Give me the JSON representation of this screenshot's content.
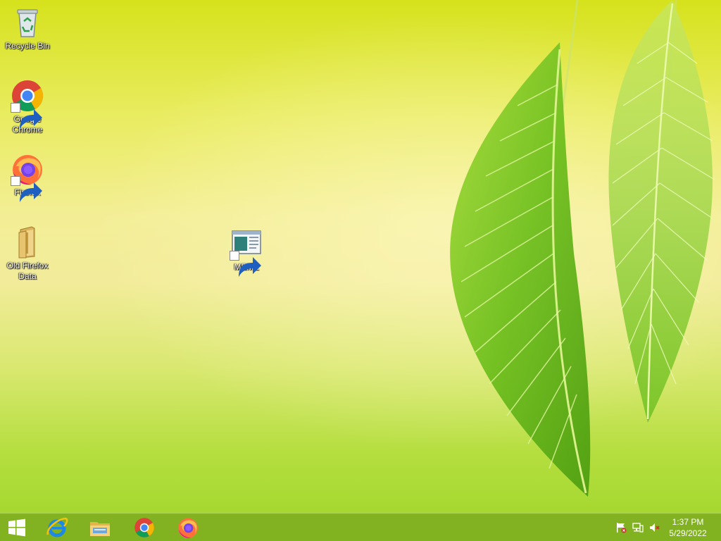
{
  "desktop": {
    "icons": [
      {
        "label": "Recycle Bin"
      },
      {
        "label": "Google Chrome"
      },
      {
        "label": "Firefox"
      },
      {
        "label": "Old Firefox Data"
      },
      {
        "label": "MEMZ"
      }
    ]
  },
  "taskbar": {
    "start_icon": "windows-logo-icon",
    "pinned": [
      {
        "icon": "internet-explorer-icon"
      },
      {
        "icon": "file-explorer-icon"
      },
      {
        "icon": "chrome-icon"
      },
      {
        "icon": "firefox-icon"
      }
    ],
    "tray": {
      "icons": [
        "action-center-flag-icon",
        "network-icon",
        "volume-muted-icon"
      ],
      "time": "1:37 PM",
      "date": "5/29/2022"
    }
  },
  "colors": {
    "taskbar": "#78a81e",
    "leaf": "#7cc52a",
    "chrome_red": "#db4437",
    "chrome_green": "#0f9d58",
    "chrome_yellow": "#f4b400",
    "chrome_blue": "#4285f4"
  }
}
